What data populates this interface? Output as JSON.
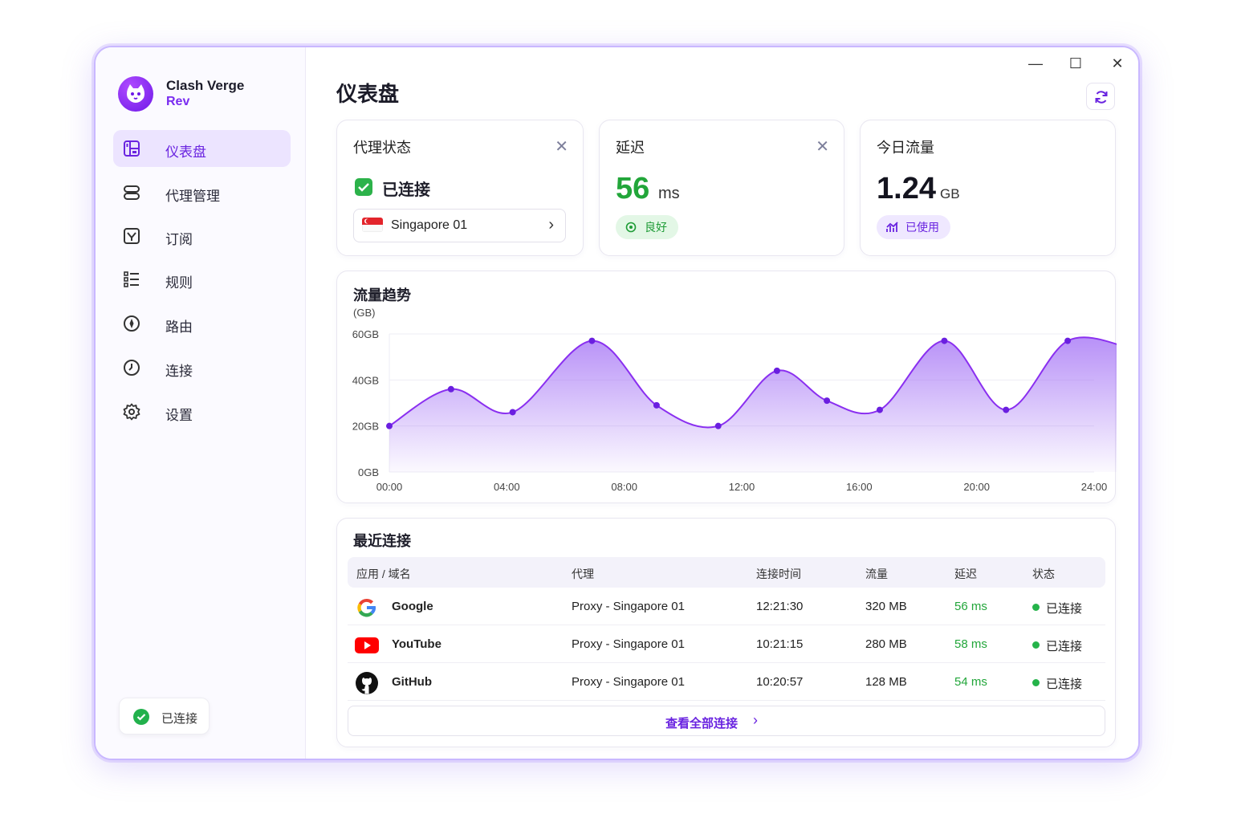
{
  "app": {
    "name": "Clash Verge",
    "sub": "Rev"
  },
  "sidebar": {
    "items": [
      {
        "label": "仪表盘",
        "icon": "dashboard-icon",
        "active": true
      },
      {
        "label": "代理管理",
        "icon": "proxy-icon"
      },
      {
        "label": "订阅",
        "icon": "subscription-icon"
      },
      {
        "label": "规则",
        "icon": "rules-icon"
      },
      {
        "label": "路由",
        "icon": "route-icon"
      },
      {
        "label": "连接",
        "icon": "connections-icon"
      },
      {
        "label": "设置",
        "icon": "gear-icon"
      }
    ],
    "status": "已连接"
  },
  "window": {
    "minimize": "—",
    "maximize": "☐",
    "close": "✕"
  },
  "page": {
    "title": "仪表盘"
  },
  "cards": {
    "proxy": {
      "title": "代理状态",
      "status": "已连接",
      "node": "Singapore 01"
    },
    "latency": {
      "title": "延迟",
      "value": "56",
      "unit": "ms",
      "badge": "良好"
    },
    "traffic": {
      "title": "今日流量",
      "value": "1.24",
      "unit": "GB",
      "badge": "已使用"
    }
  },
  "colors": {
    "accent": "#6a24e0",
    "good": "#22a63a",
    "line": "#8a2ff0"
  },
  "chart_data": {
    "type": "area",
    "title": "流量趋势",
    "ylabel": "(GB)",
    "ylim": [
      0,
      60
    ],
    "y_ticks": [
      "60GB",
      "40GB",
      "20GB",
      "0GB"
    ],
    "y_tick_values": [
      60,
      40,
      20,
      0
    ],
    "x_ticks": [
      "00:00",
      "04:00",
      "08:00",
      "12:00",
      "16:00",
      "20:00",
      "24:00"
    ],
    "x": [
      0,
      2.1,
      4.2,
      6.9,
      9.1,
      11.2,
      13.2,
      14.9,
      16.7,
      18.9,
      21.0,
      23.1,
      25.2
    ],
    "values": [
      20,
      36,
      26,
      57,
      29,
      20,
      44,
      31,
      27,
      57,
      27,
      57,
      54
    ],
    "grid": true
  },
  "table": {
    "title": "最近连接",
    "headers": [
      "应用 / 域名",
      "代理",
      "连接时间",
      "流量",
      "延迟",
      "状态"
    ],
    "rows": [
      {
        "app": "Google",
        "icon": "google-icon",
        "proxy": "Proxy - Singapore 01",
        "time": "12:21:30",
        "traffic": "320 MB",
        "latency": "56 ms",
        "status": "已连接"
      },
      {
        "app": "YouTube",
        "icon": "youtube-icon",
        "proxy": "Proxy - Singapore 01",
        "time": "10:21:15",
        "traffic": "280 MB",
        "latency": "58 ms",
        "status": "已连接"
      },
      {
        "app": "GitHub",
        "icon": "github-icon",
        "proxy": "Proxy - Singapore 01",
        "time": "10:20:57",
        "traffic": "128 MB",
        "latency": "54 ms",
        "status": "已连接"
      }
    ],
    "view_all": "查看全部连接"
  }
}
